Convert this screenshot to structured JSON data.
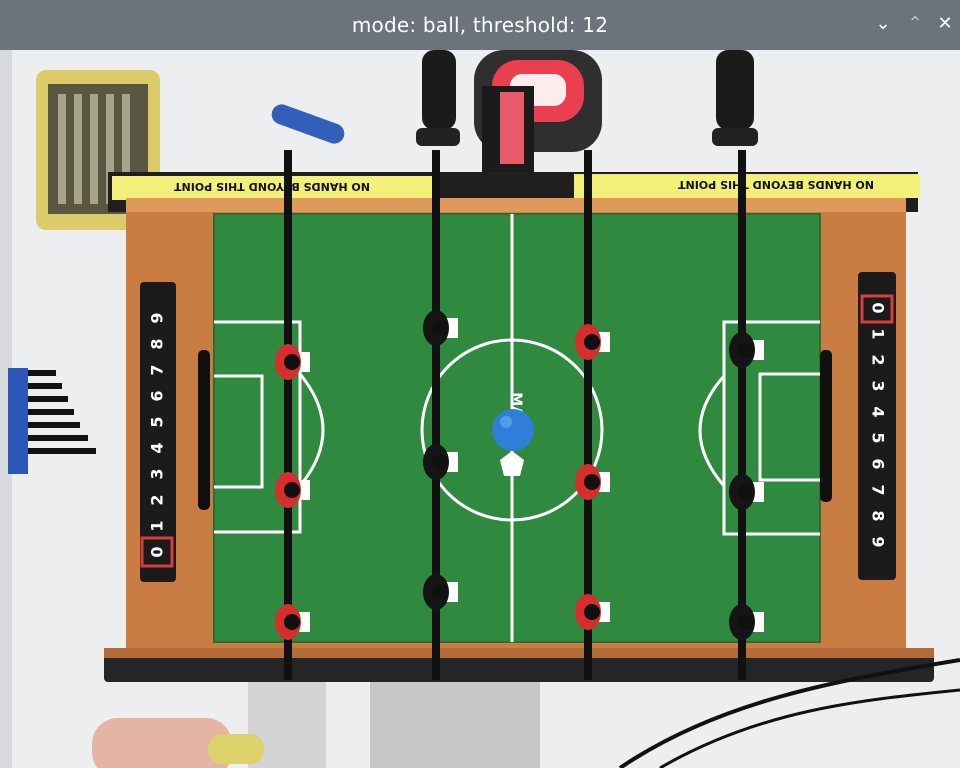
{
  "window": {
    "title": "mode: ball, threshold: 12",
    "buttons": {
      "minimize_icon": "chevron-down-icon",
      "maximize_icon": "chevron-up-icon",
      "close_icon": "close-icon"
    }
  },
  "camera_view": {
    "left_sign": "NO HANDS BEYOND THIS POINT",
    "right_sign": "NO HANDS BEYOND THIS POINT",
    "left_score_digits": [
      "9",
      "8",
      "7",
      "6",
      "5",
      "4",
      "3",
      "2",
      "1",
      "0"
    ],
    "right_score_digits": [
      "0",
      "1",
      "2",
      "3",
      "4",
      "5",
      "6",
      "7",
      "8",
      "9"
    ],
    "center_logo": "MAX",
    "colors": {
      "field": "#2f8a3f",
      "wood": "#c97d42",
      "ball": "#2f7fd8",
      "red_player": "#d82d2d",
      "black_player": "#151515",
      "tape": "#f3f07a"
    }
  }
}
